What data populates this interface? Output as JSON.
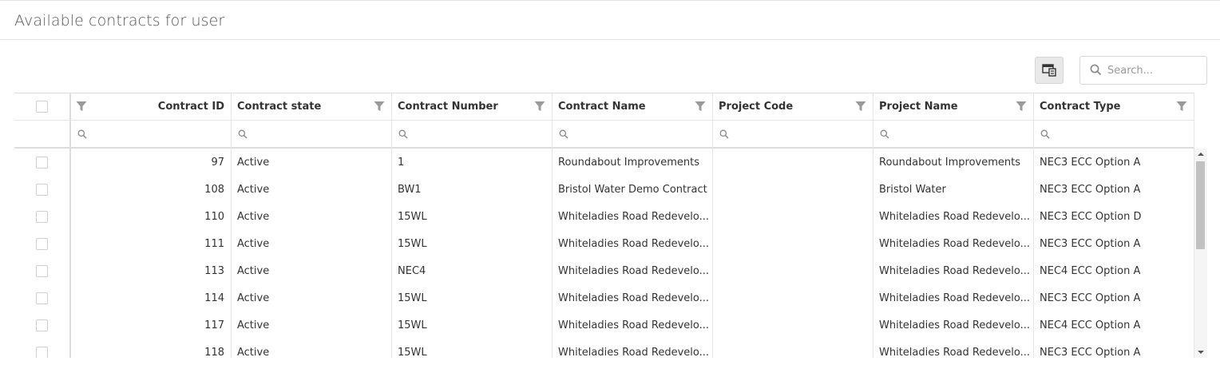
{
  "header": {
    "title": "Available contracts for user"
  },
  "toolbar": {
    "column_chooser_icon": "column-chooser-icon",
    "search": {
      "placeholder": "Search...",
      "value": "",
      "icon": "search-icon"
    }
  },
  "grid": {
    "columns": [
      {
        "key": "contract_id",
        "label": "Contract ID"
      },
      {
        "key": "contract_state",
        "label": "Contract state"
      },
      {
        "key": "contract_number",
        "label": "Contract Number"
      },
      {
        "key": "contract_name",
        "label": "Contract Name"
      },
      {
        "key": "project_code",
        "label": "Project Code"
      },
      {
        "key": "project_name",
        "label": "Project Name"
      },
      {
        "key": "contract_type",
        "label": "Contract Type"
      }
    ],
    "rows": [
      {
        "contract_id": "97",
        "contract_state": "Active",
        "contract_number": "1",
        "contract_name": "Roundabout Improvements",
        "project_code": "",
        "project_name": "Roundabout Improvements",
        "contract_type": "NEC3 ECC Option A"
      },
      {
        "contract_id": "108",
        "contract_state": "Active",
        "contract_number": "BW1",
        "contract_name": "Bristol Water Demo Contract",
        "project_code": "",
        "project_name": "Bristol Water",
        "contract_type": "NEC3 ECC Option A"
      },
      {
        "contract_id": "110",
        "contract_state": "Active",
        "contract_number": "15WL",
        "contract_name": "Whiteladies Road Redevelo...",
        "project_code": "",
        "project_name": "Whiteladies Road Redevelo...",
        "contract_type": "NEC3 ECC Option D"
      },
      {
        "contract_id": "111",
        "contract_state": "Active",
        "contract_number": "15WL",
        "contract_name": "Whiteladies Road Redevelo...",
        "project_code": "",
        "project_name": "Whiteladies Road Redevelo...",
        "contract_type": "NEC3 ECC Option A"
      },
      {
        "contract_id": "113",
        "contract_state": "Active",
        "contract_number": "NEC4",
        "contract_name": "Whiteladies Road Redevelo...",
        "project_code": "",
        "project_name": "Whiteladies Road Redevelo...",
        "contract_type": "NEC4 ECC Option A"
      },
      {
        "contract_id": "114",
        "contract_state": "Active",
        "contract_number": "15WL",
        "contract_name": "Whiteladies Road Redevelo...",
        "project_code": "",
        "project_name": "Whiteladies Road Redevelo...",
        "contract_type": "NEC3 ECC Option A"
      },
      {
        "contract_id": "117",
        "contract_state": "Active",
        "contract_number": "15WL",
        "contract_name": "Whiteladies Road Redevelo...",
        "project_code": "",
        "project_name": "Whiteladies Road Redevelo...",
        "contract_type": "NEC4 ECC Option A"
      },
      {
        "contract_id": "118",
        "contract_state": "Active",
        "contract_number": "15WL",
        "contract_name": "Whiteladies Road Redevelo...",
        "project_code": "",
        "project_name": "Whiteladies Road Redevelo...",
        "contract_type": "NEC3 ECC Option A"
      }
    ]
  },
  "icons": {
    "filter": "filter-funnel-icon",
    "filter_row_search": "search-icon",
    "scroll_up": "arrow-up-icon",
    "scroll_down": "arrow-down-icon"
  },
  "colors": {
    "border": "#dddddd",
    "header_text": "#333333",
    "muted": "#999999",
    "button_bg": "#e8e8e8"
  }
}
